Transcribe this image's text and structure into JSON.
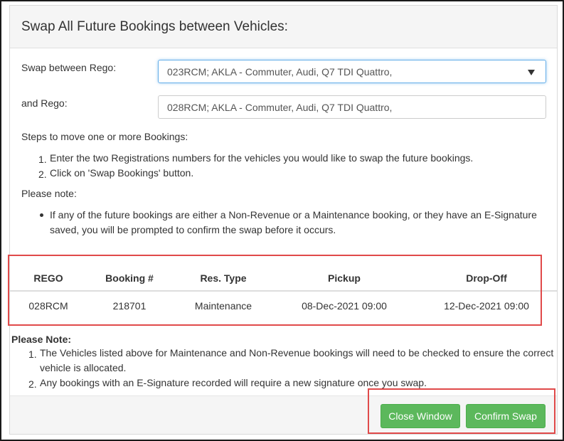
{
  "dialog": {
    "title": "Swap All Future Bookings between Vehicles:"
  },
  "form": {
    "swap_label": "Swap between Rego:",
    "swap_value": "023RCM; AKLA - Commuter, Audi, Q7 TDI Quattro,",
    "and_label": "and Rego:",
    "and_value": "028RCM; AKLA - Commuter, Audi, Q7 TDI Quattro,"
  },
  "steps": {
    "heading": "Steps to move one or more Bookings:",
    "items": [
      {
        "num": "1.",
        "text": "Enter the two Registrations numbers for the vehicles you would like to swap the future bookings."
      },
      {
        "num": "2.",
        "text": "Click on 'Swap Bookings' button."
      }
    ]
  },
  "note": {
    "heading": "Please note:",
    "bullet": "If any of the future bookings are either a Non-Revenue or a Maintenance booking, or they have an E-Signature saved, you will be prompted to confirm the swap before it occurs."
  },
  "table": {
    "headers": [
      "REGO",
      "Booking #",
      "Res. Type",
      "Pickup",
      "Drop-Off"
    ],
    "rows": [
      [
        "028RCM",
        "218701",
        "Maintenance",
        "08-Dec-2021 09:00",
        "12-Dec-2021 09:00"
      ]
    ]
  },
  "please_note": {
    "heading": "Please Note:",
    "items": [
      {
        "num": "1.",
        "line1": "The Vehicles listed above for Maintenance and Non-Revenue bookings will need to be checked to ensure the correct",
        "line2": "vehicle is allocated."
      },
      {
        "num": "2.",
        "line1": "Any bookings with an E-Signature recorded will require a new signature once you swap."
      }
    ]
  },
  "buttons": {
    "close": "Close Window",
    "confirm": "Confirm Swap"
  },
  "colors": {
    "button_green": "#5cb85c",
    "highlight_red": "#e04a4a",
    "focus_blue": "#66afe9"
  },
  "icons": {
    "select_caret": "chevron-down-icon"
  }
}
